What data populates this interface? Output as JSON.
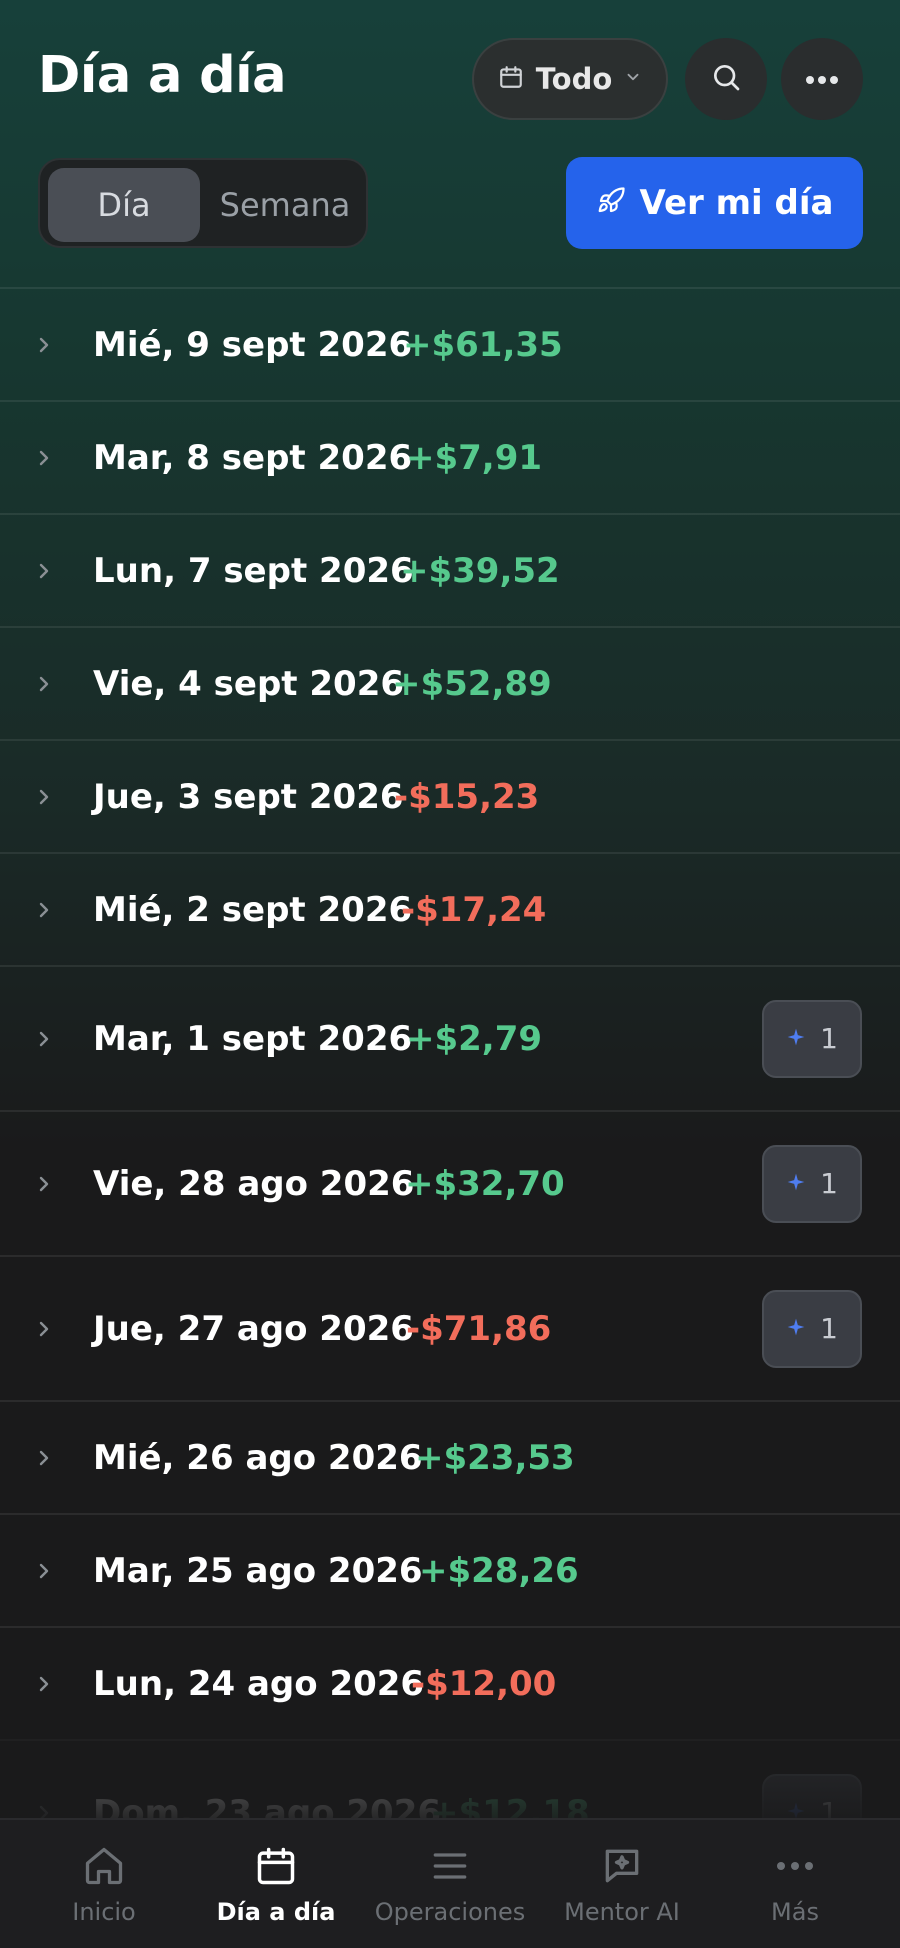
{
  "header": {
    "title": "Día a día",
    "filter_label": "Todo",
    "cta_label": "Ver mi día"
  },
  "segmented": {
    "active": "Día",
    "inactive": "Semana"
  },
  "days": [
    {
      "date": "Mié, 9 sept 2026",
      "amount": "+$61,35",
      "sign": "pos",
      "badge": ""
    },
    {
      "date": "Mar, 8 sept 2026",
      "amount": "+$7,91",
      "sign": "pos",
      "badge": ""
    },
    {
      "date": "Lun, 7 sept 2026",
      "amount": "+$39,52",
      "sign": "pos",
      "badge": ""
    },
    {
      "date": "Vie, 4 sept 2026",
      "amount": "+$52,89",
      "sign": "pos",
      "badge": ""
    },
    {
      "date": "Jue, 3 sept 2026",
      "amount": "-$15,23",
      "sign": "neg",
      "badge": ""
    },
    {
      "date": "Mié, 2 sept 2026",
      "amount": "-$17,24",
      "sign": "neg",
      "badge": ""
    },
    {
      "date": "Mar, 1 sept 2026",
      "amount": "+$2,79",
      "sign": "pos",
      "badge": "1"
    },
    {
      "date": "Vie, 28 ago 2026",
      "amount": "+$32,70",
      "sign": "pos",
      "badge": "1"
    },
    {
      "date": "Jue, 27 ago 2026",
      "amount": "-$71,86",
      "sign": "neg",
      "badge": "1"
    },
    {
      "date": "Mié, 26 ago 2026",
      "amount": "+$23,53",
      "sign": "pos",
      "badge": ""
    },
    {
      "date": "Mar, 25 ago 2026",
      "amount": "+$28,26",
      "sign": "pos",
      "badge": ""
    },
    {
      "date": "Lun, 24 ago 2026",
      "amount": "-$12,00",
      "sign": "neg",
      "badge": ""
    },
    {
      "date": "Dom, 23 ago 2026",
      "amount": "+$12,18",
      "sign": "pos",
      "badge": "1"
    }
  ],
  "tabs": [
    {
      "label": "Inicio",
      "icon": "home-icon"
    },
    {
      "label": "Día a día",
      "icon": "calendar-icon"
    },
    {
      "label": "Operaciones",
      "icon": "list-icon"
    },
    {
      "label": "Mentor AI",
      "icon": "chat-sparkle-icon"
    },
    {
      "label": "Más",
      "icon": "more-icon"
    }
  ],
  "colors": {
    "positive": "#56c98d",
    "negative": "#f26d5b",
    "accent": "#2563eb",
    "sparkle": "#4f7df0"
  }
}
